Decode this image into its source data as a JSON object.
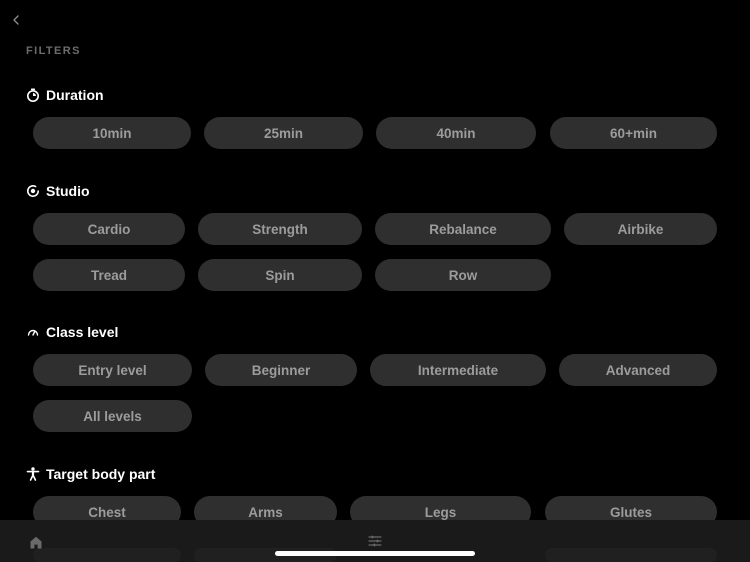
{
  "header": {
    "back_icon": "chevron-left-icon",
    "filters_label": "FILTERS"
  },
  "sections": {
    "duration": {
      "title": "Duration",
      "icon": "stopwatch-icon",
      "options": [
        "10min",
        "25min",
        "40min",
        "60+min"
      ]
    },
    "studio": {
      "title": "Studio",
      "icon": "studio-icon",
      "options": [
        "Cardio",
        "Strength",
        "Rebalance",
        "Airbike",
        "Tread",
        "Spin",
        "Row"
      ]
    },
    "class_level": {
      "title": "Class level",
      "icon": "gauge-icon",
      "options": [
        "Entry level",
        "Beginner",
        "Intermediate",
        "Advanced",
        "All levels"
      ]
    },
    "target_body_part": {
      "title": "Target body part",
      "icon": "person-icon",
      "options": [
        "Chest",
        "Arms",
        "Legs",
        "Glutes"
      ]
    }
  },
  "tab_bar": {
    "items": [
      {
        "icon": "home-icon"
      },
      {
        "icon": "sliders-icon"
      }
    ]
  },
  "colors": {
    "background": "#000000",
    "chip_background": "#2f2f2f",
    "chip_text": "#9c9c9c",
    "section_label": "#6c6c6c",
    "tab_bar": "#1a1a1a"
  }
}
